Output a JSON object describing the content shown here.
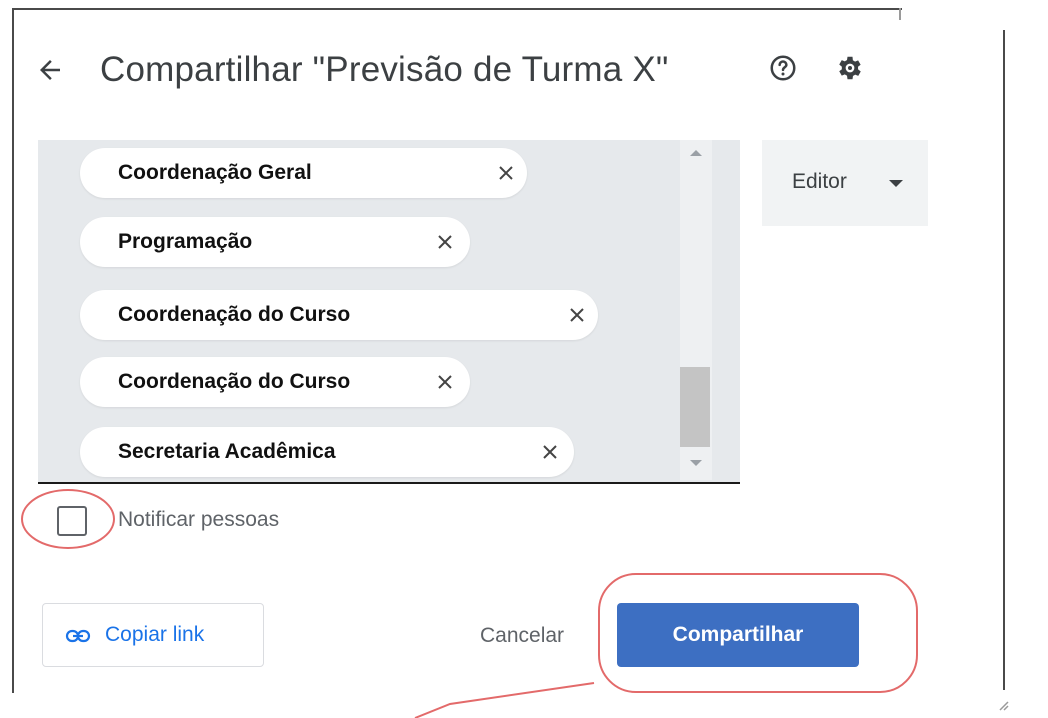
{
  "dialog": {
    "title": "Compartilhar \"Previsão de Turma X\"",
    "icons": {
      "back": "arrow-left-icon",
      "help": "help-circle-icon",
      "settings": "gear-icon"
    }
  },
  "recipients": [
    {
      "label": "Coordenação Geral"
    },
    {
      "label": "Programação"
    },
    {
      "label": "Coordenação do Curso"
    },
    {
      "label": "Coordenação do Curso"
    },
    {
      "label": "Secretaria Acadêmica"
    }
  ],
  "role": {
    "selected": "Editor"
  },
  "notify": {
    "label": "Notificar pessoas",
    "checked": false
  },
  "actions": {
    "copy_link": "Copiar link",
    "cancel": "Cancelar",
    "share": "Compartilhar"
  },
  "colors": {
    "primary": "#3d6fc2",
    "link": "#1a73e8",
    "chips_background": "#e6e9ec",
    "annotation": "#e36a6a"
  }
}
